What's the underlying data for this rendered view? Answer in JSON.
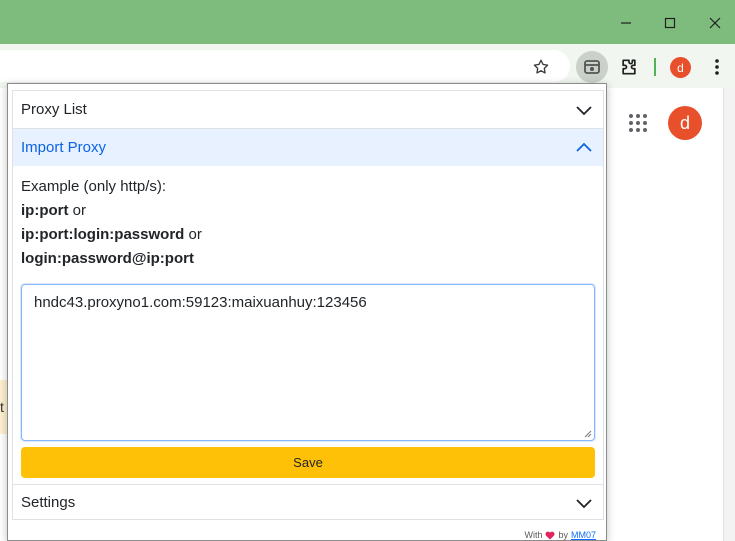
{
  "browser": {
    "profile_initial": "d",
    "colors": {
      "titlebar": "#7ebc7e",
      "toolbar": "#f1f6f0",
      "avatar": "#e8502b"
    },
    "icons": [
      "minimize-icon",
      "maximize-icon",
      "close-icon",
      "star-icon",
      "proxy-extension-icon",
      "puzzle-icon",
      "more-vert-icon",
      "apps-grid-icon"
    ]
  },
  "page": {
    "profile_initial": "d",
    "left_edge_text": "t"
  },
  "popup": {
    "proxy_list": {
      "label": "Proxy List"
    },
    "import_proxy": {
      "label": "Import Proxy",
      "example_intro": "Example (only http/s):",
      "formats": [
        {
          "text": "ip:port",
          "suffix": " or"
        },
        {
          "text": "ip:port:login:password",
          "suffix": " or"
        },
        {
          "text": "login:password@ip:port",
          "suffix": ""
        }
      ],
      "textarea_value": "hndc43.proxyno1.com:59123:maixuanhuy:123456",
      "save_label": "Save"
    },
    "settings": {
      "label": "Settings"
    },
    "footer": {
      "prefix": "With",
      "suffix": "by",
      "link": "MM07"
    },
    "colors": {
      "accent": "#0c63e4",
      "active_bg": "#e7f1ff",
      "save": "#ffc107",
      "heart": "#e0245e"
    }
  }
}
